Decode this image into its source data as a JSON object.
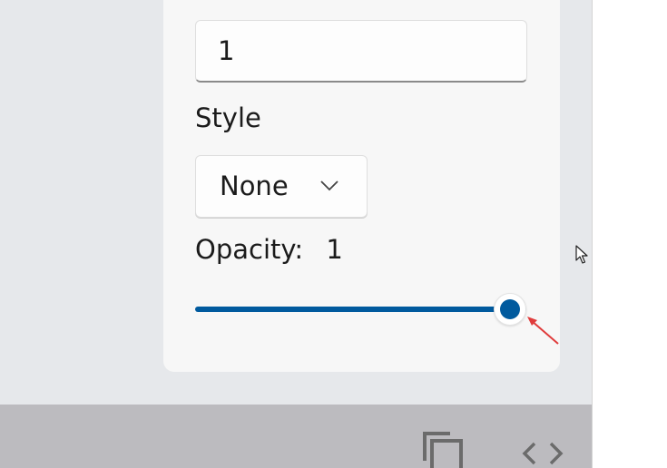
{
  "width_input": {
    "value": "1"
  },
  "style": {
    "label": "Style",
    "selected": "None"
  },
  "opacity": {
    "label": "Opacity:",
    "value": "1",
    "fraction": 1.0
  },
  "bottom_bar": {
    "copy_icon": "copy-icon",
    "code_icon": "code-icon"
  },
  "colors": {
    "accent": "#005a9e",
    "panel": "#f7f7f7",
    "background": "#e6e8eb",
    "bottom_bar": "#bcbbbf",
    "annotation": "#e03c3c"
  }
}
